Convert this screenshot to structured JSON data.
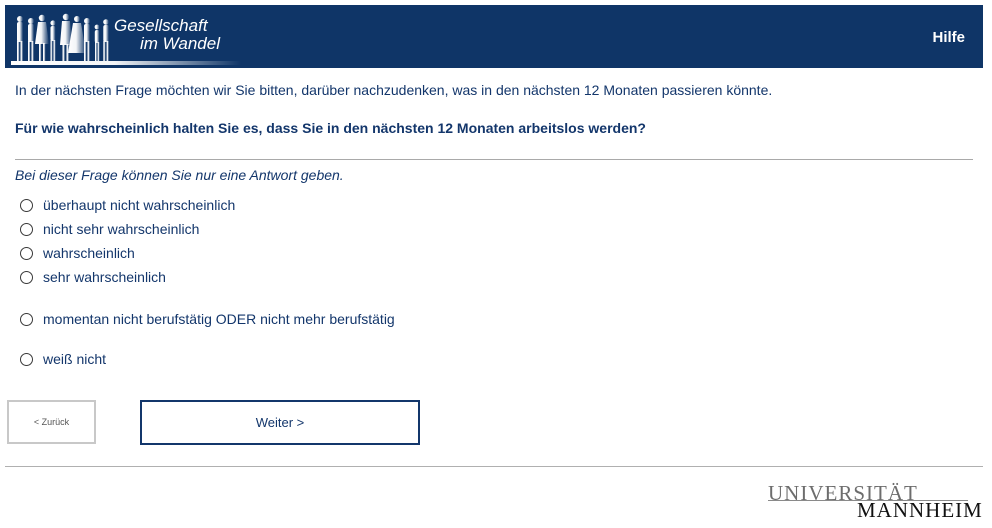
{
  "header": {
    "logo_line1": "Gesellschaft",
    "logo_line2": "im Wandel",
    "help_label": "Hilfe"
  },
  "survey": {
    "intro": "In der nächsten Frage möchten wir Sie bitten, darüber nachzudenken, was in den nächsten 12 Monaten passieren könnte.",
    "question": "Für wie wahrscheinlich halten Sie es, dass Sie in den nächsten 12 Monaten arbeitslos werden?",
    "instruction": "Bei dieser Frage können Sie nur eine Antwort geben.",
    "options": [
      {
        "label": "überhaupt nicht wahrscheinlich"
      },
      {
        "label": "nicht sehr wahrscheinlich"
      },
      {
        "label": "wahrscheinlich"
      },
      {
        "label": "sehr wahrscheinlich"
      },
      {
        "label": "momentan nicht berufstätig ODER nicht mehr berufstätig"
      },
      {
        "label": "weiß nicht"
      }
    ]
  },
  "nav": {
    "back_label": "< Zurück",
    "next_label": "Weiter >"
  },
  "footer": {
    "uni_line1": "UNIVERSITÄT",
    "uni_line2": "MANNHEIM"
  },
  "colors": {
    "header_bg": "#0f3567",
    "text": "#13366b"
  }
}
